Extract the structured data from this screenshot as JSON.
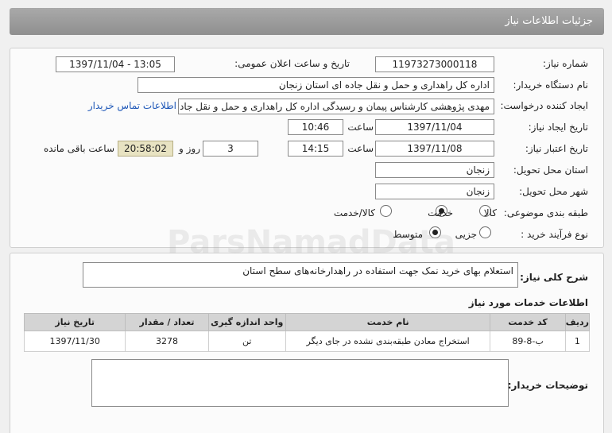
{
  "header": {
    "title": "جزئیات اطلاعات نیاز"
  },
  "form": {
    "need_number_label": "شماره نیاز:",
    "need_number": "11973273000118",
    "announce_label": "تاریخ و ساعت اعلان عمومی:",
    "announce_value": "1397/11/04 - 13:05",
    "buyer_org_label": "نام دستگاه خریدار:",
    "buyer_org": "اداره کل راهداری و حمل و نقل جاده ای استان زنجان",
    "requester_label": "ایجاد کننده درخواست:",
    "requester": "مهدی پژوهشی کارشناس پیمان و رسیدگی اداره کل راهداری و حمل و نقل جاده",
    "contact_link": "اطلاعات تماس خریدار",
    "created_label": "تاریخ ایجاد نیاز:",
    "created_date": "1397/11/04",
    "time_label": "ساعت",
    "created_time": "10:46",
    "validity_label": "تاریخ اعتبار نیاز:",
    "validity_date": "1397/11/08",
    "validity_time": "14:15",
    "days_value": "3",
    "days_label": "روز و",
    "remaining_value": "20:58:02",
    "remaining_label": "ساعت باقی مانده",
    "province_label": "استان محل تحویل:",
    "province": "زنجان",
    "city_label": "شهر محل تحویل:",
    "city": "زنجان",
    "category_label": "طبقه بندی موضوعی:",
    "category_options": [
      "کالا",
      "خدمت",
      "کالا/خدمت"
    ],
    "category_selected": "خدمت",
    "process_label": "نوع فرآیند خرید :",
    "process_options": [
      "جزیی",
      "متوسط"
    ],
    "process_selected": "متوسط"
  },
  "summary": {
    "label": "شرح کلی نیاز:",
    "text": "استعلام بهای خرید نمک جهت استفاده در راهدارخانه‌های سطح استان"
  },
  "services": {
    "title": "اطلاعات خدمات مورد نیاز",
    "columns": [
      "ردیف",
      "کد خدمت",
      "نام خدمت",
      "واحد اندازه گیری",
      "تعداد / مقدار",
      "تاریخ نیاز"
    ],
    "rows": [
      [
        "1",
        "ب-8-89",
        "استخراج معادن طبقه‌بندی نشده در جای دیگر",
        "تن",
        "3278",
        "1397/11/30"
      ]
    ]
  },
  "buyer_notes": {
    "label": "توضیحات خریدار:",
    "text": ""
  },
  "watermark": "ParsNamadData"
}
